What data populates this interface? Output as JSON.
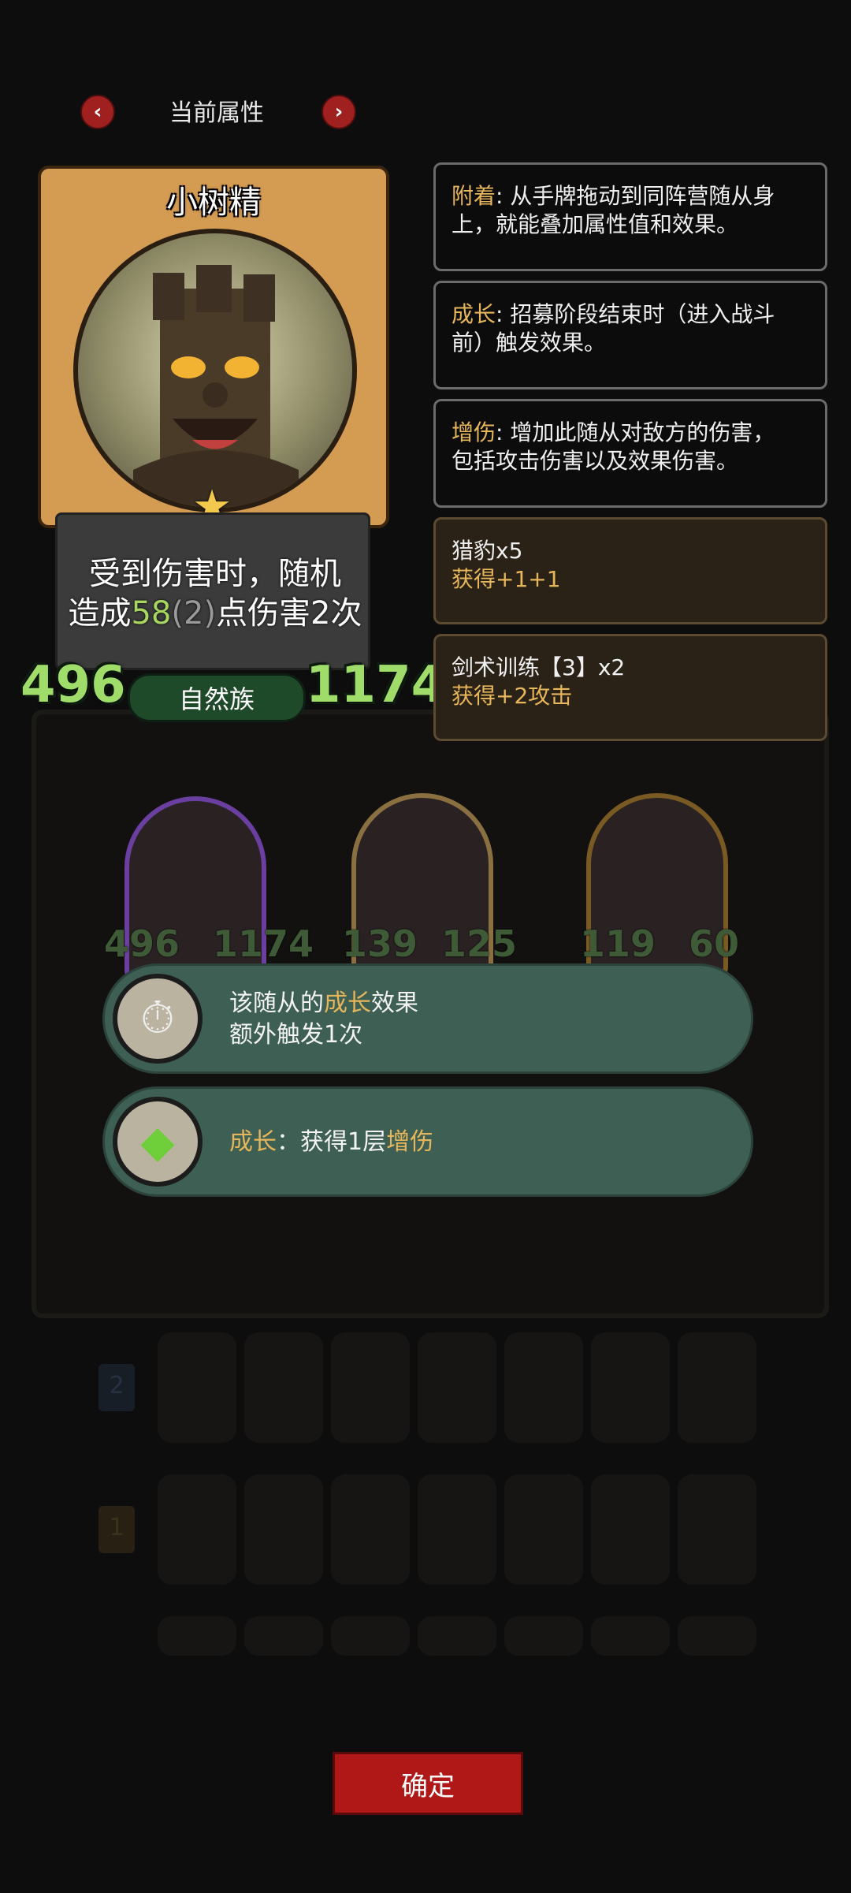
{
  "header": {
    "title": "当前属性",
    "prev_icon": "‹",
    "next_icon": "›"
  },
  "card": {
    "name": "小树精",
    "desc_line1": "受到伤害时，随机",
    "desc_prefix": "造成",
    "desc_damage": "58",
    "desc_bonus": "(2)",
    "desc_suffix": "点伤害2次",
    "attack": "496",
    "health": "1174",
    "tribe": "自然族",
    "star": "★"
  },
  "panels": [
    {
      "keyword": "附着",
      "line1": ": 从手牌拖动到同阵营随从身",
      "line2": "上，就能叠加属性值和效果。"
    },
    {
      "keyword": "成长",
      "line1": ": 招募阶段结束时（进入战斗",
      "line2": "前）触发效果。"
    },
    {
      "keyword": "增伤",
      "line1": ": 增加此随从对敌方的伤害，",
      "line2": "包括攻击伤害以及效果伤害。"
    },
    {
      "title": "猎豹x5",
      "effect": "获得+1+1"
    },
    {
      "title": "剑术训练【3】x2",
      "effect": "获得+2攻击"
    }
  ],
  "board_minions": [
    {
      "attack": "496",
      "health": "1174"
    },
    {
      "attack": "139",
      "health": "125"
    },
    {
      "attack": "119",
      "health": "60"
    }
  ],
  "popups": [
    {
      "text_a": "该随从的",
      "keyword": "成长",
      "text_b": "效果",
      "line2": "额外触发1次",
      "icon": "⏱"
    },
    {
      "keyword_a": "成长",
      "text_a": "：获得1层",
      "keyword_b": "增伤",
      "icon": "◆"
    }
  ],
  "tier_tags": [
    "2",
    "1"
  ],
  "confirm_label": "确定",
  "colors": {
    "keyword": "#e7b65a",
    "stat_green": "#9fdc6a",
    "popup_bg": "#3e5f54",
    "confirm_red": "#b01818"
  }
}
